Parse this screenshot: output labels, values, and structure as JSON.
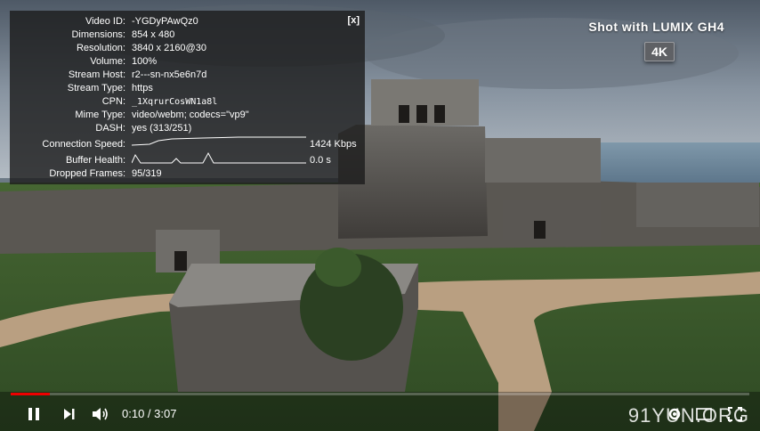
{
  "stats": {
    "close_label": "[x]",
    "rows": [
      {
        "label": "Video ID:",
        "value": "-YGDyPAwQz0"
      },
      {
        "label": "Dimensions:",
        "value": "854 x 480"
      },
      {
        "label": "Resolution:",
        "value": "3840 x 2160@30"
      },
      {
        "label": "Volume:",
        "value": "100%"
      },
      {
        "label": "Stream Host:",
        "value": "r2---sn-nx5e6n7d"
      },
      {
        "label": "Stream Type:",
        "value": "https"
      },
      {
        "label": "CPN:",
        "value": "_1XqrurCosWN1a8l"
      },
      {
        "label": "Mime Type:",
        "value": "video/webm; codecs=\"vp9\""
      },
      {
        "label": "DASH:",
        "value": "yes (313/251)"
      },
      {
        "label": "Connection Speed:",
        "value": "1424 Kbps"
      },
      {
        "label": "Buffer Health:",
        "value": "0.0 s"
      },
      {
        "label": "Dropped Frames:",
        "value": "95/319"
      }
    ]
  },
  "overlay": {
    "brand": "Shot with LUMIX GH4",
    "badge": "4K"
  },
  "player": {
    "current_time": "0:10",
    "separator": "/",
    "duration": "3:07",
    "time_display": "0:10 / 3:07",
    "progress_fraction": 0.053,
    "progress_color": "#ee0000"
  },
  "watermark": "91YUN.ORG",
  "icons": {
    "pause": "pause-icon",
    "next": "next-icon",
    "volume": "volume-icon",
    "settings": "settings-icon",
    "miniplayer": "miniplayer-icon",
    "fullscreen": "fullscreen-icon"
  }
}
